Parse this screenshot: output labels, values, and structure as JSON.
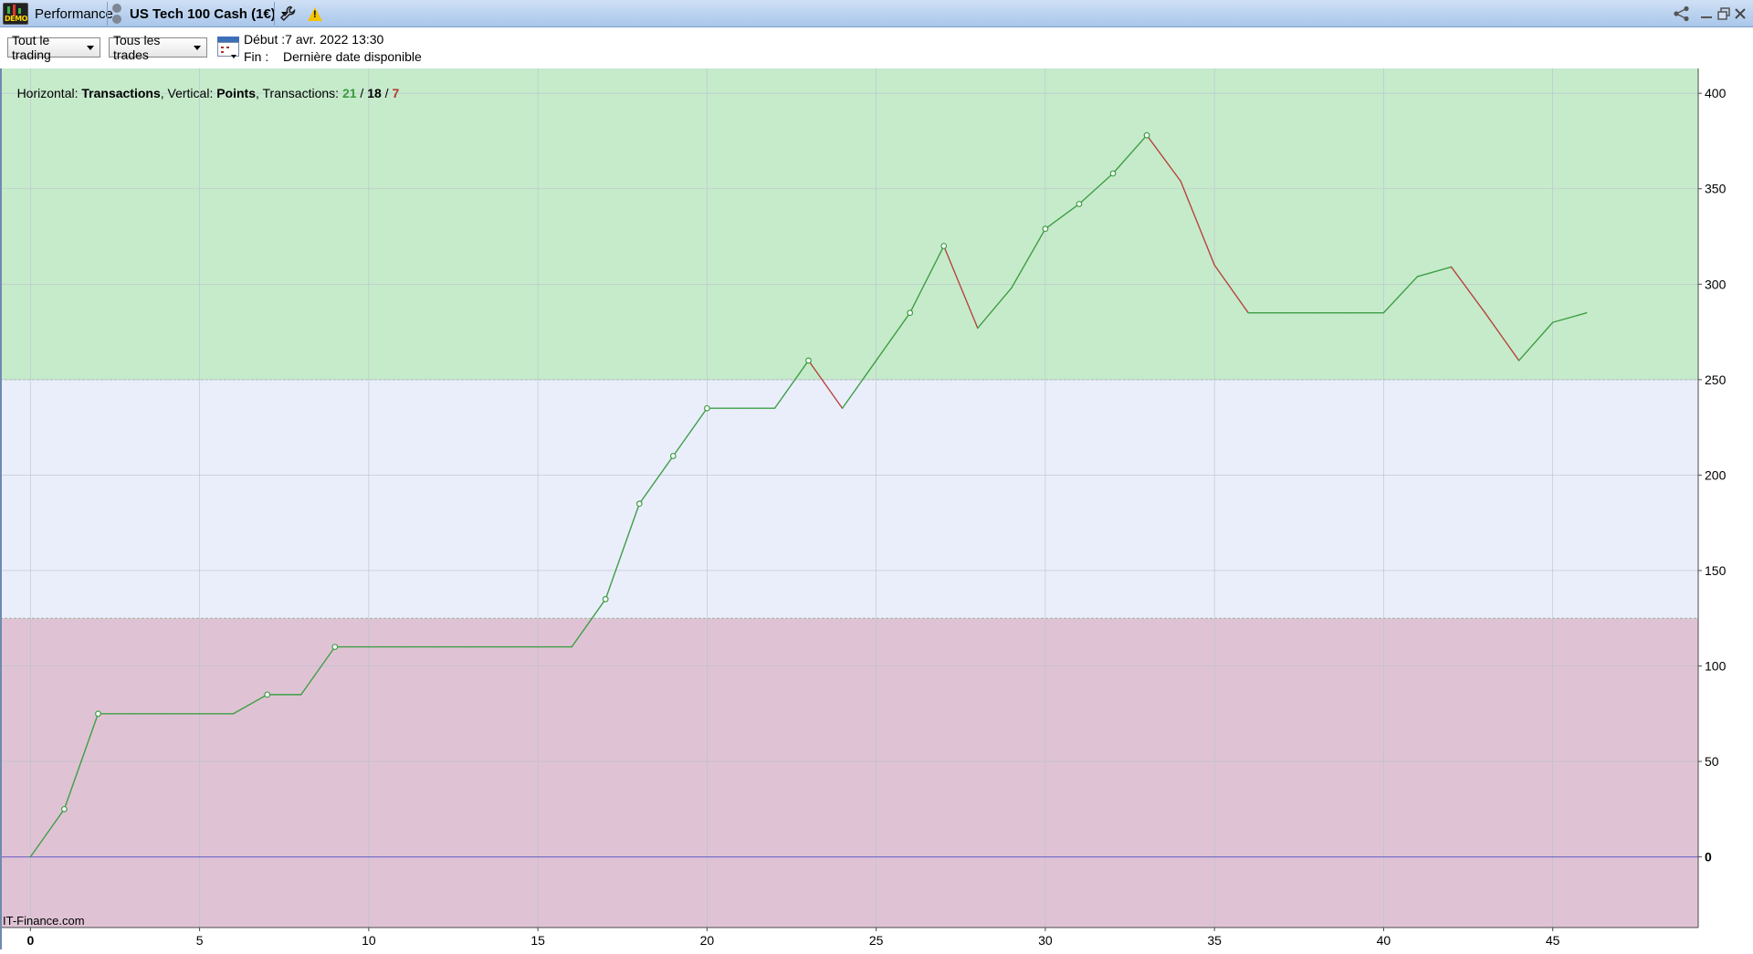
{
  "titlebar": {
    "demo_badge": "DEMO",
    "module_label": "Performance",
    "instrument_label": "US Tech 100 Cash (1€)",
    "icons": [
      "demo-icon",
      "instrument-icon",
      "wrench-icon",
      "warning-icon",
      "share-icon",
      "minimize-icon",
      "restore-icon",
      "close-icon"
    ]
  },
  "toolbar": {
    "trading_filter": "Tout le trading",
    "trades_filter": "Tous les trades",
    "start_label": "Début :",
    "start_value": "7 avr. 2022 13:30",
    "end_label": "Fin :",
    "end_value": "Dernière date disponible"
  },
  "info_bar": {
    "horizontal_label": "Horizontal: ",
    "horizontal_value": "Transactions",
    "vertical_label": ", Vertical: ",
    "vertical_value": "Points",
    "transactions_label": ", Transactions: ",
    "total": "21",
    "slash1": " / ",
    "winners": "18",
    "slash2": " / ",
    "losers": "7"
  },
  "watermark": "IT-Finance.com",
  "chart_data": {
    "type": "line",
    "xlim": [
      -0.9,
      49.3
    ],
    "ylim": [
      -37,
      413
    ],
    "x_ticks": [
      0,
      5,
      10,
      15,
      20,
      25,
      30,
      35,
      40,
      45
    ],
    "x_tick_labels": [
      "0",
      "5",
      "10",
      "15",
      "20",
      "25",
      "30",
      "35",
      "40",
      "45"
    ],
    "y_ticks": [
      0,
      50,
      100,
      150,
      200,
      250,
      300,
      350,
      400
    ],
    "y_tick_labels": [
      "0",
      "50",
      "100",
      "150",
      "200",
      "250",
      "300",
      "350",
      "400"
    ],
    "grid": true,
    "zones": [
      {
        "from": 250,
        "to": 413,
        "color": "#c6ebcb"
      },
      {
        "from": 125,
        "to": 250,
        "color": "#eaeefb"
      },
      {
        "from": -37,
        "to": 125,
        "color": "#dfc3d4"
      }
    ],
    "zero_line_color": "#7b6fc8",
    "series": [
      {
        "x": [
          0,
          1,
          2,
          3,
          4,
          5,
          6,
          7,
          8,
          9,
          10,
          11,
          12,
          13,
          14,
          15,
          16,
          17,
          18,
          19,
          20,
          21,
          22,
          23,
          24,
          25,
          26,
          27,
          28,
          29,
          30,
          31,
          32,
          33,
          34,
          35,
          36,
          37,
          38,
          39,
          40,
          41,
          42,
          43,
          44,
          45,
          46
        ],
        "values": [
          0,
          25,
          75,
          75,
          75,
          75,
          75,
          85,
          85,
          110,
          110,
          110,
          110,
          110,
          110,
          110,
          110,
          135,
          185,
          210,
          235,
          235,
          235,
          260,
          235,
          260,
          285,
          320,
          277,
          298,
          329,
          342,
          358,
          378,
          354,
          310,
          285,
          285,
          285,
          285,
          285,
          304,
          309,
          285,
          260,
          280,
          285
        ],
        "markers": [
          1,
          2,
          7,
          9,
          17,
          18,
          19,
          20,
          23,
          26,
          27,
          30,
          31,
          32,
          33
        ]
      }
    ],
    "up_color": "#3f9e45",
    "down_color": "#b5463e",
    "marker_color": "#3f9e45"
  }
}
